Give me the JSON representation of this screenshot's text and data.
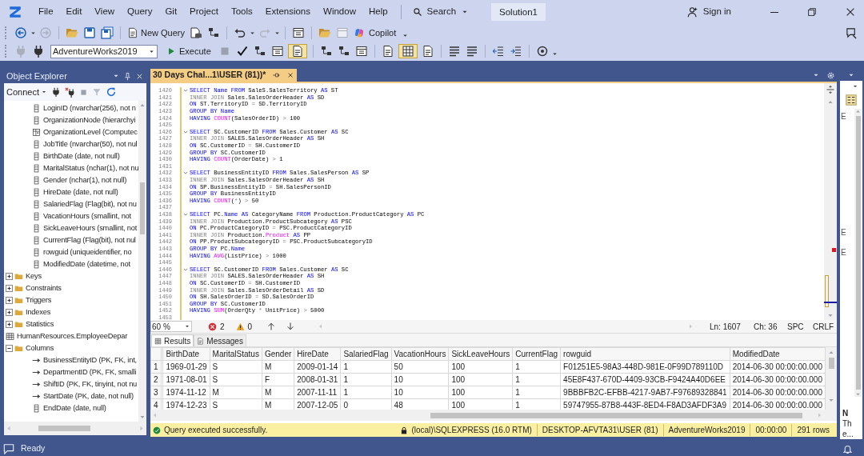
{
  "menu": [
    "File",
    "Edit",
    "View",
    "Query",
    "Git",
    "Project",
    "Tools",
    "Extensions",
    "Window",
    "Help"
  ],
  "search": {
    "label": "Search"
  },
  "solution": "Solution1",
  "sign_in": "Sign in",
  "toolbar": {
    "new_query": "New Query",
    "copilot": "Copilot",
    "database": "AdventureWorks2019",
    "execute": "Execute"
  },
  "object_explorer": {
    "title": "Object Explorer",
    "connect": "Connect",
    "tree": [
      {
        "kind": "continued",
        "children": [
          {
            "kind": "column",
            "label": "LoginID (nvarchar(256), not n"
          },
          {
            "kind": "column",
            "label": "OrganizationNode (hierarchyi"
          },
          {
            "kind": "computed",
            "label": "OrganizationLevel (Computec"
          },
          {
            "kind": "column",
            "label": "JobTitle (nvarchar(50), not nul"
          },
          {
            "kind": "column",
            "label": "BirthDate (date, not null)"
          },
          {
            "kind": "column",
            "label": "MaritalStatus (nchar(1), not nu"
          },
          {
            "kind": "column",
            "label": "Gender (nchar(1), not null)"
          },
          {
            "kind": "column",
            "label": "HireDate (date, not null)"
          },
          {
            "kind": "column",
            "label": "SalariedFlag (Flag(bit), not nu"
          },
          {
            "kind": "column",
            "label": "VacationHours (smallint, not"
          },
          {
            "kind": "column",
            "label": "SickLeaveHours (smallint, not"
          },
          {
            "kind": "column",
            "label": "CurrentFlag (Flag(bit), not nul"
          },
          {
            "kind": "column",
            "label": "rowguid (uniqueidentifier, no"
          },
          {
            "kind": "column",
            "label": "ModifiedDate (datetime, not"
          }
        ]
      },
      {
        "kind": "folder",
        "label": "Keys",
        "expanded": false
      },
      {
        "kind": "folder",
        "label": "Constraints",
        "expanded": false
      },
      {
        "kind": "folder",
        "label": "Triggers",
        "expanded": false
      },
      {
        "kind": "folder",
        "label": "Indexes",
        "expanded": false
      },
      {
        "kind": "folder",
        "label": "Statistics",
        "expanded": false
      },
      {
        "kind": "table",
        "label": "HumanResources.EmployeeDepar",
        "children": [
          {
            "kind": "folder",
            "label": "Columns",
            "expanded": true,
            "children": [
              {
                "kind": "key_column",
                "label": "BusinessEntityID (PK, FK, int,"
              },
              {
                "kind": "key_column",
                "label": "DepartmentID (PK, FK, smalli"
              },
              {
                "kind": "key_column",
                "label": "ShiftID (PK, FK, tinyint, not nu"
              },
              {
                "kind": "key_column",
                "label": "StartDate (PK, date, not null)"
              },
              {
                "kind": "column",
                "label": "EndDate (date, null)"
              }
            ]
          }
        ]
      }
    ]
  },
  "editor": {
    "tab": "30 Days Chal...1\\USER (81))*",
    "lines": [
      {
        "number": "1420",
        "fold": true,
        "tokens": [
          {
            "kind": "keyword",
            "text": "SELECT Name FROM"
          },
          {
            "kind": "plain",
            "text": " SaleS.SalesTerritory"
          },
          {
            "kind": "keyword",
            "text": " AS"
          },
          {
            "kind": "plain",
            "text": " ST"
          }
        ]
      },
      {
        "number": "1421",
        "fold": false,
        "tokens": [
          {
            "kind": "join",
            "text": "INNER JOIN"
          },
          {
            "kind": "plain",
            "text": " Sales.SalesOrderHeader"
          },
          {
            "kind": "keyword",
            "text": " AS"
          },
          {
            "kind": "plain",
            "text": " SD"
          }
        ]
      },
      {
        "number": "1422",
        "fold": false,
        "tokens": [
          {
            "kind": "keyword",
            "text": "ON"
          },
          {
            "kind": "plain",
            "text": " ST.TerritoryID"
          },
          {
            "kind": "operator",
            "text": " ="
          },
          {
            "kind": "plain",
            "text": " SD.TerritoryID"
          }
        ]
      },
      {
        "number": "1423",
        "fold": false,
        "tokens": [
          {
            "kind": "keyword",
            "text": "GROUP BY Name"
          }
        ]
      },
      {
        "number": "1424",
        "fold": false,
        "tokens": [
          {
            "kind": "keyword",
            "text": "HAVING"
          },
          {
            "kind": "function",
            "text": " COUNT"
          },
          {
            "kind": "plain",
            "text": "(SalesOrderID)"
          },
          {
            "kind": "operator",
            "text": " >"
          },
          {
            "kind": "plain",
            "text": " 100"
          }
        ]
      },
      {
        "number": "1425",
        "fold": false
      },
      {
        "number": "1426",
        "fold": true,
        "tokens": [
          {
            "kind": "keyword",
            "text": "SELECT"
          },
          {
            "kind": "plain",
            "text": " SC.CustomerID"
          },
          {
            "kind": "keyword",
            "text": " FROM"
          },
          {
            "kind": "plain",
            "text": " Sales.Customer"
          },
          {
            "kind": "keyword",
            "text": " AS"
          },
          {
            "kind": "plain",
            "text": " SC"
          }
        ]
      },
      {
        "number": "1427",
        "fold": false,
        "tokens": [
          {
            "kind": "join",
            "text": "INNER JOIN"
          },
          {
            "kind": "plain",
            "text": " SALES.SalesOrderHeader"
          },
          {
            "kind": "keyword",
            "text": " AS"
          },
          {
            "kind": "plain",
            "text": " SH"
          }
        ]
      },
      {
        "number": "1428",
        "fold": false,
        "tokens": [
          {
            "kind": "keyword",
            "text": "ON"
          },
          {
            "kind": "plain",
            "text": " SC.CustomerID"
          },
          {
            "kind": "operator",
            "text": " ="
          },
          {
            "kind": "plain",
            "text": " SH.CustomerID"
          }
        ]
      },
      {
        "number": "1429",
        "fold": false,
        "tokens": [
          {
            "kind": "keyword",
            "text": "GROUP BY"
          },
          {
            "kind": "plain",
            "text": " SC.CustomerID"
          }
        ]
      },
      {
        "number": "1430",
        "fold": false,
        "tokens": [
          {
            "kind": "keyword",
            "text": "HAVING"
          },
          {
            "kind": "function",
            "text": " COUNT"
          },
          {
            "kind": "plain",
            "text": "(OrderDate)"
          },
          {
            "kind": "operator",
            "text": " >"
          },
          {
            "kind": "plain",
            "text": " 1"
          }
        ]
      },
      {
        "number": "1431",
        "fold": false
      },
      {
        "number": "1432",
        "fold": true,
        "tokens": [
          {
            "kind": "keyword",
            "text": "SELECT"
          },
          {
            "kind": "plain",
            "text": " BusinessEntityID"
          },
          {
            "kind": "keyword",
            "text": " FROM"
          },
          {
            "kind": "plain",
            "text": " Sales.SalesPerson"
          },
          {
            "kind": "keyword",
            "text": " AS"
          },
          {
            "kind": "plain",
            "text": " SP"
          }
        ]
      },
      {
        "number": "1433",
        "fold": false,
        "tokens": [
          {
            "kind": "join",
            "text": "INNER JOIN"
          },
          {
            "kind": "plain",
            "text": " Sales.SalesOrderHeader"
          },
          {
            "kind": "keyword",
            "text": " AS"
          },
          {
            "kind": "plain",
            "text": " SH"
          }
        ]
      },
      {
        "number": "1434",
        "fold": false,
        "tokens": [
          {
            "kind": "keyword",
            "text": "ON"
          },
          {
            "kind": "plain",
            "text": " SP.BusinessEntityID"
          },
          {
            "kind": "operator",
            "text": " ="
          },
          {
            "kind": "plain",
            "text": " SH.SalesPersonID"
          }
        ]
      },
      {
        "number": "1435",
        "fold": false,
        "tokens": [
          {
            "kind": "keyword",
            "text": "GROUP BY"
          },
          {
            "kind": "plain",
            "text": " BusinessEntityID"
          }
        ]
      },
      {
        "number": "1436",
        "fold": false,
        "tokens": [
          {
            "kind": "keyword",
            "text": "HAVING"
          },
          {
            "kind": "function",
            "text": " COUNT"
          },
          {
            "kind": "plain",
            "text": "("
          },
          {
            "kind": "operator",
            "text": "*"
          },
          {
            "kind": "plain",
            "text": ")"
          },
          {
            "kind": "operator",
            "text": " >"
          },
          {
            "kind": "plain",
            "text": " 50"
          }
        ]
      },
      {
        "number": "1437",
        "fold": false
      },
      {
        "number": "1438",
        "fold": true,
        "tokens": [
          {
            "kind": "keyword",
            "text": "SELECT"
          },
          {
            "kind": "plain",
            "text": " PC."
          },
          {
            "kind": "keyword",
            "text": "Name AS"
          },
          {
            "kind": "plain",
            "text": " CategoryName"
          },
          {
            "kind": "keyword",
            "text": " FROM"
          },
          {
            "kind": "plain",
            "text": " Production.ProductCategory"
          },
          {
            "kind": "keyword",
            "text": " AS"
          },
          {
            "kind": "plain",
            "text": " PC"
          }
        ]
      },
      {
        "number": "1439",
        "fold": false,
        "tokens": [
          {
            "kind": "join",
            "text": "INNER JOIN"
          },
          {
            "kind": "plain",
            "text": " Production.ProductSubcategory"
          },
          {
            "kind": "keyword",
            "text": " AS"
          },
          {
            "kind": "plain",
            "text": " PSC"
          }
        ]
      },
      {
        "number": "1440",
        "fold": false,
        "tokens": [
          {
            "kind": "keyword",
            "text": "ON"
          },
          {
            "kind": "plain",
            "text": " PC.ProductCategoryID"
          },
          {
            "kind": "operator",
            "text": " ="
          },
          {
            "kind": "plain",
            "text": " PSC.ProductCategoryID"
          }
        ]
      },
      {
        "number": "1441",
        "fold": false,
        "tokens": [
          {
            "kind": "join",
            "text": "INNER JOIN"
          },
          {
            "kind": "plain",
            "text": " Production."
          },
          {
            "kind": "function",
            "text": "Product"
          },
          {
            "kind": "keyword",
            "text": " AS"
          },
          {
            "kind": "plain",
            "text": " PP"
          }
        ]
      },
      {
        "number": "1442",
        "fold": false,
        "tokens": [
          {
            "kind": "keyword",
            "text": "ON"
          },
          {
            "kind": "plain",
            "text": " PP.ProductSubcategoryID"
          },
          {
            "kind": "operator",
            "text": " ="
          },
          {
            "kind": "plain",
            "text": " PSC.ProductSubcategoryID"
          }
        ]
      },
      {
        "number": "1443",
        "fold": false,
        "tokens": [
          {
            "kind": "keyword",
            "text": "GROUP BY"
          },
          {
            "kind": "plain",
            "text": " PC."
          },
          {
            "kind": "keyword",
            "text": "Name"
          }
        ]
      },
      {
        "number": "1444",
        "fold": false,
        "tokens": [
          {
            "kind": "keyword",
            "text": "HAVING"
          },
          {
            "kind": "function",
            "text": " AVG"
          },
          {
            "kind": "plain",
            "text": "(ListPrice)"
          },
          {
            "kind": "operator",
            "text": " >"
          },
          {
            "kind": "plain",
            "text": " 1000"
          }
        ]
      },
      {
        "number": "1445",
        "fold": false
      },
      {
        "number": "1446",
        "fold": true,
        "tokens": [
          {
            "kind": "keyword",
            "text": "SELECT"
          },
          {
            "kind": "plain",
            "text": " SC.CustomerID"
          },
          {
            "kind": "keyword",
            "text": " FROM"
          },
          {
            "kind": "plain",
            "text": " Sales.Customer"
          },
          {
            "kind": "keyword",
            "text": " AS"
          },
          {
            "kind": "plain",
            "text": " SC"
          }
        ]
      },
      {
        "number": "1447",
        "fold": false,
        "tokens": [
          {
            "kind": "join",
            "text": "INNER JOIN"
          },
          {
            "kind": "plain",
            "text": " SALES.SalesOrderHeader"
          },
          {
            "kind": "keyword",
            "text": " AS"
          },
          {
            "kind": "plain",
            "text": " SH"
          }
        ]
      },
      {
        "number": "1448",
        "fold": false,
        "tokens": [
          {
            "kind": "keyword",
            "text": "ON"
          },
          {
            "kind": "plain",
            "text": " SC.CustomerID"
          },
          {
            "kind": "operator",
            "text": " ="
          },
          {
            "kind": "plain",
            "text": " SH.CustomerID"
          }
        ]
      },
      {
        "number": "1449",
        "fold": false,
        "tokens": [
          {
            "kind": "join",
            "text": "INNER JOIN"
          },
          {
            "kind": "plain",
            "text": " Sales.SalesOrderDetail"
          },
          {
            "kind": "keyword",
            "text": " AS"
          },
          {
            "kind": "plain",
            "text": " SD"
          }
        ]
      },
      {
        "number": "1450",
        "fold": false,
        "tokens": [
          {
            "kind": "keyword",
            "text": "ON"
          },
          {
            "kind": "plain",
            "text": " SH.SalesOrderID"
          },
          {
            "kind": "operator",
            "text": " ="
          },
          {
            "kind": "plain",
            "text": " SD.SalesOrderID"
          }
        ]
      },
      {
        "number": "1451",
        "fold": false,
        "tokens": [
          {
            "kind": "keyword",
            "text": "GROUP BY"
          },
          {
            "kind": "plain",
            "text": " SC.CustomerID"
          }
        ]
      },
      {
        "number": "1452",
        "fold": false,
        "tokens": [
          {
            "kind": "keyword",
            "text": "HAVING"
          },
          {
            "kind": "function",
            "text": " SUM"
          },
          {
            "kind": "plain",
            "text": "(OrderQty"
          },
          {
            "kind": "operator",
            "text": " *"
          },
          {
            "kind": "plain",
            "text": " UnitPrice)"
          },
          {
            "kind": "operator",
            "text": " >"
          },
          {
            "kind": "plain",
            "text": " 5000"
          }
        ]
      },
      {
        "number": "1453",
        "fold": false
      }
    ],
    "zoom": "60 %",
    "errors": "2",
    "warnings": "0",
    "position": [
      "Ln: 1607",
      "Ch: 36",
      "SPC",
      "CRLF"
    ]
  },
  "results": {
    "tabs": [
      {
        "label": "Results",
        "selected": true
      },
      {
        "label": "Messages",
        "selected": false
      }
    ],
    "columns": [
      "BirthDate",
      "MaritalStatus",
      "Gender",
      "HireDate",
      "SalariedFlag",
      "VacationHours",
      "SickLeaveHours",
      "CurrentFlag",
      "rowguid",
      "ModifiedDate"
    ],
    "rows": [
      {
        "number": "1",
        "cells": [
          "1969-01-29",
          "S",
          "M",
          "2009-01-14",
          "1",
          "50",
          "100",
          "1",
          "F01251E5-98A3-448D-981E-0F99D789110D",
          "2014-06-30 00:00:00.000"
        ]
      },
      {
        "number": "2",
        "cells": [
          "1971-08-01",
          "S",
          "F",
          "2008-01-31",
          "1",
          "10",
          "100",
          "1",
          "45E8F437-670D-4409-93CB-F9424A40D6EE",
          "2014-06-30 00:00:00.000"
        ]
      },
      {
        "number": "3",
        "cells": [
          "1974-11-12",
          "M",
          "M",
          "2007-11-11",
          "1",
          "10",
          "100",
          "1",
          "9BBBFB2C-EFBB-4217-9AB7-F97689328841",
          "2014-06-30 00:00:00.000"
        ]
      },
      {
        "number": "4",
        "cells": [
          "1974-12-23",
          "S",
          "M",
          "2007-12-05",
          "0",
          "48",
          "100",
          "1",
          "59747955-87B8-443F-8ED4-F8AD3AFDF3A9",
          "2014-06-30 00:00:00.000"
        ]
      }
    ]
  },
  "query_status": {
    "message": "Query executed successfully.",
    "server": "(local)\\SQLEXPRESS (16.0 RTM)",
    "user": "DESKTOP-AFVTA31\\USER (81)",
    "database": "AdventureWorks2019",
    "elapsed": "00:00:00",
    "rows": "291 rows"
  },
  "side_panel": {
    "markers": [
      "E",
      "E",
      "E"
    ],
    "caption": [
      "N",
      "Th",
      "e..."
    ]
  },
  "status_bar": {
    "text": "Ready"
  }
}
